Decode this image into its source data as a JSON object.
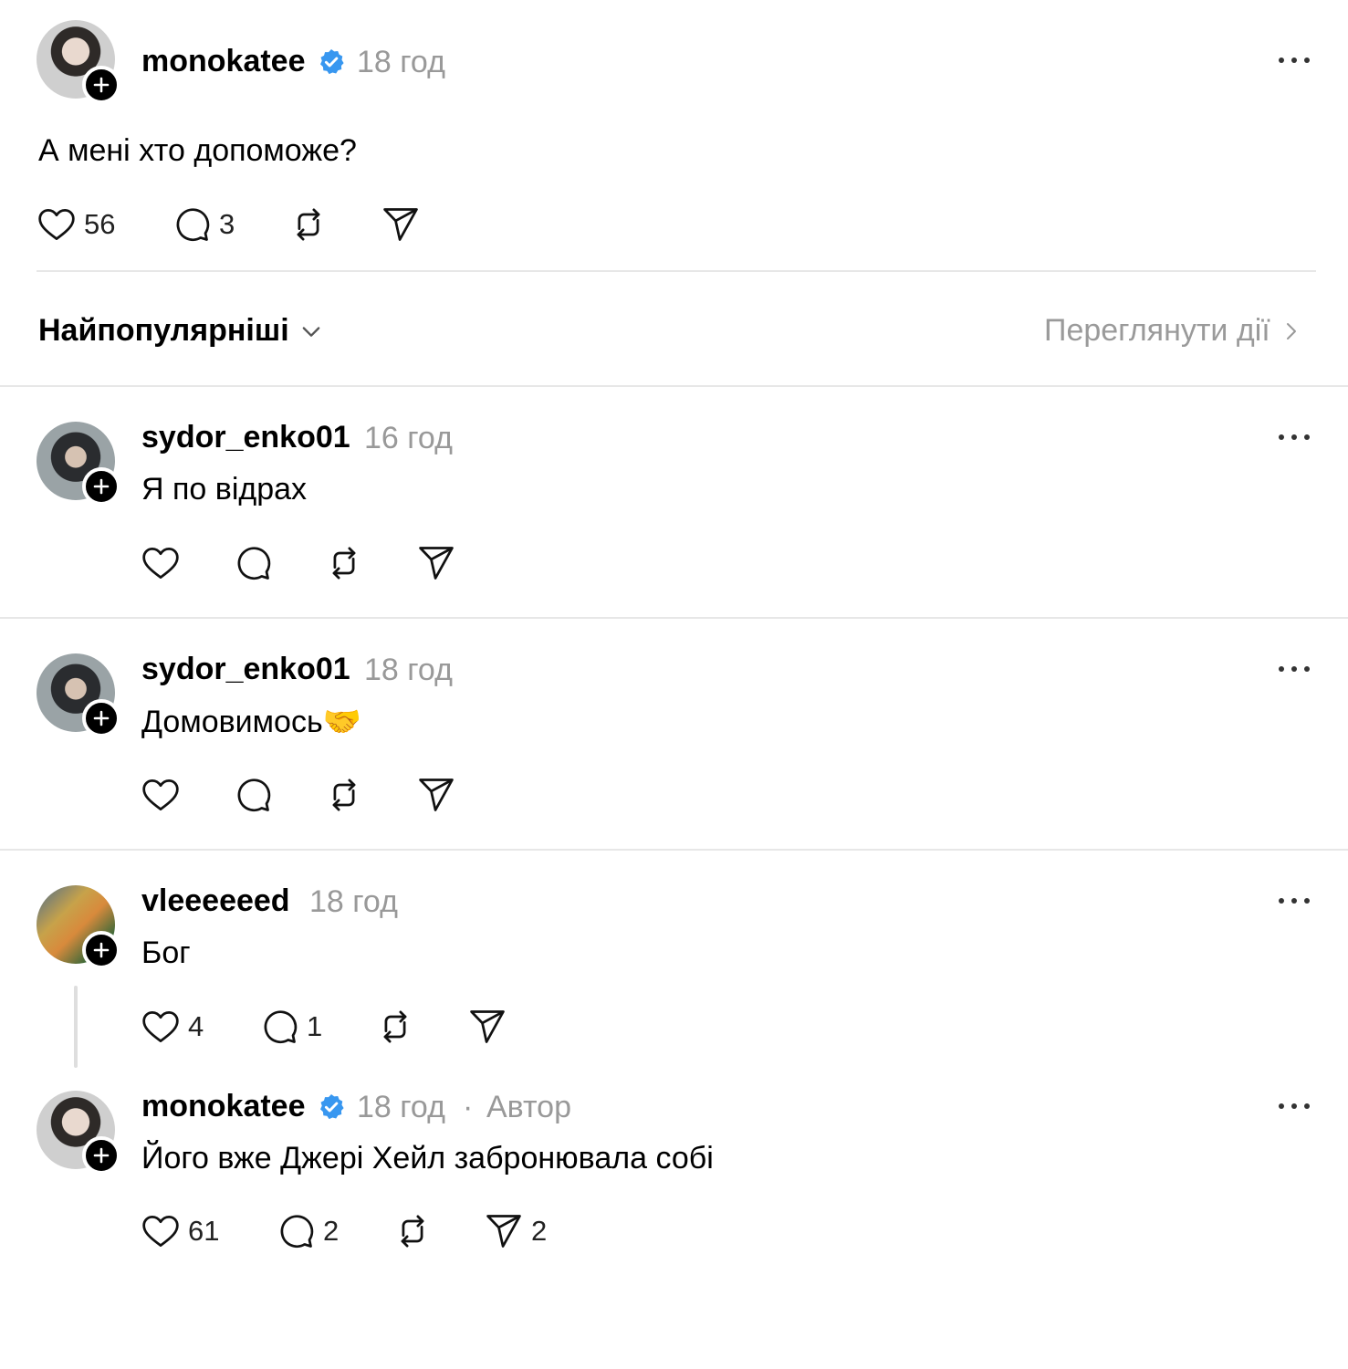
{
  "post": {
    "username": "monokatee",
    "time": "18 год",
    "text": "А мені хто допоможе?",
    "likes": "56",
    "comments": "3"
  },
  "sort_bar": {
    "sort_label": "Найпопулярніші",
    "view_activity": "Переглянути дії"
  },
  "replies": [
    {
      "username": "sydor_enko01",
      "time": "16 год",
      "text": "Я по відрах"
    },
    {
      "username": "sydor_enko01",
      "time": "18 год",
      "text": "Домовимось🤝"
    },
    {
      "username": "vleeeeeed",
      "time": "18 год",
      "text": "Бог",
      "likes": "4",
      "comments": "1"
    },
    {
      "username": "monokatee",
      "time": "18 год",
      "dot": "·",
      "author_label": "Автор",
      "text": "Його вже Джері Хейл забронювала собі",
      "likes": "61",
      "comments": "2",
      "shares": "2"
    }
  ],
  "colors": {
    "verified": "#3897f0",
    "muted": "#999999",
    "divider": "#e7e7e7"
  },
  "icons": [
    "heart-icon",
    "comment-icon",
    "repost-icon",
    "share-icon",
    "more-icon",
    "verified-icon",
    "plus-icon",
    "chevron-down-icon",
    "chevron-right-icon"
  ]
}
